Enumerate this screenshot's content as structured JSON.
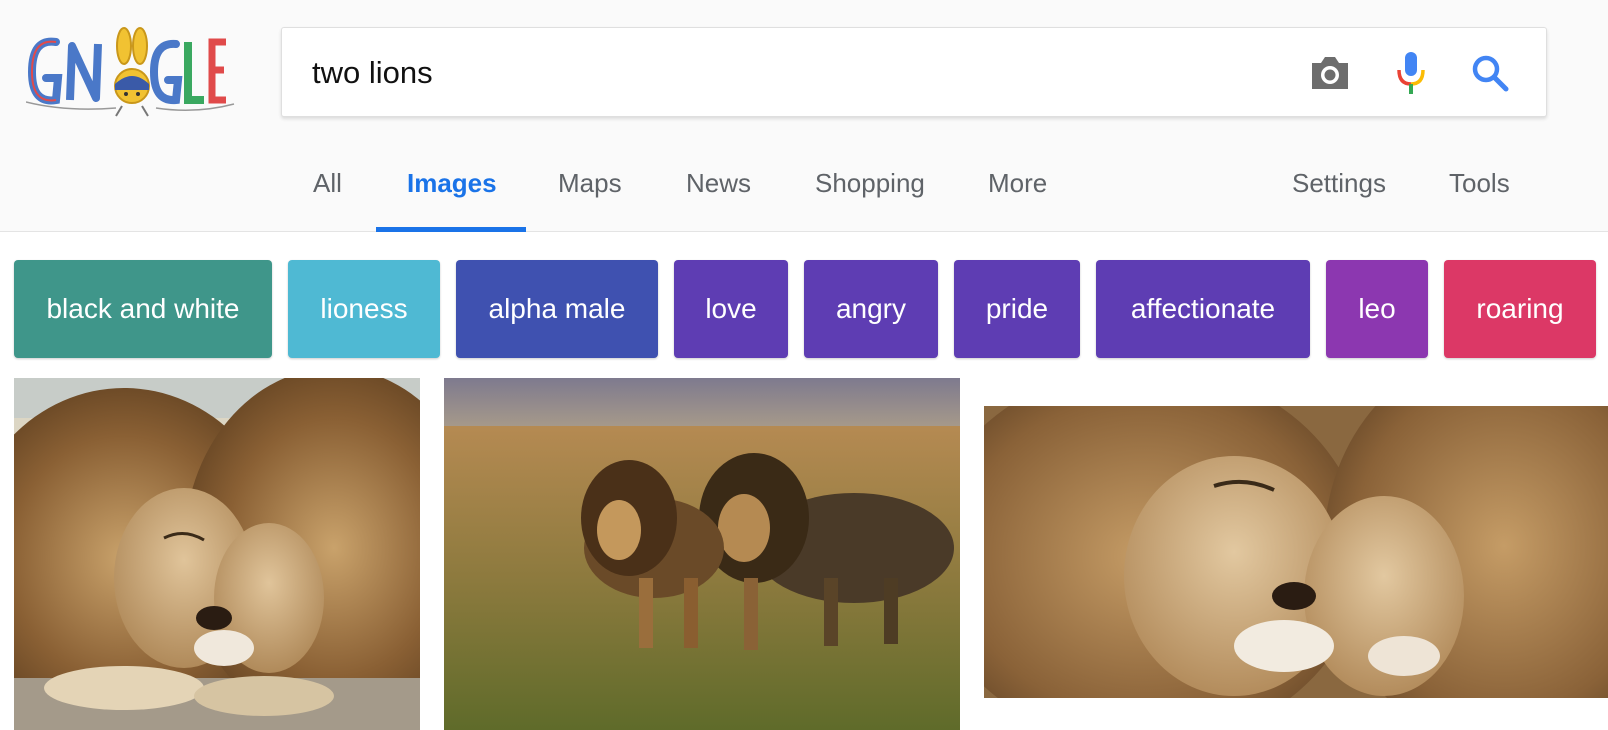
{
  "search": {
    "query": "two lions"
  },
  "icons": {
    "camera": "camera-icon",
    "mic": "microphone-icon",
    "search": "search-icon"
  },
  "tabs": [
    {
      "label": "All"
    },
    {
      "label": "Images"
    },
    {
      "label": "Maps"
    },
    {
      "label": "News"
    },
    {
      "label": "Shopping"
    },
    {
      "label": "More"
    },
    {
      "label": "Settings"
    },
    {
      "label": "Tools"
    }
  ],
  "chips": [
    {
      "label": "black and white",
      "color": "#3f968a"
    },
    {
      "label": "lioness",
      "color": "#4fb9d3"
    },
    {
      "label": "alpha male",
      "color": "#3f51b0"
    },
    {
      "label": "love",
      "color": "#5e3db3"
    },
    {
      "label": "angry",
      "color": "#5e3db3"
    },
    {
      "label": "pride",
      "color": "#5e3db3"
    },
    {
      "label": "affectionate",
      "color": "#5e3db3"
    },
    {
      "label": "leo",
      "color": "#8c37b0"
    },
    {
      "label": "roaring",
      "color": "#dc3866"
    }
  ],
  "colors": {
    "accent": "#1a73e8",
    "tab_text": "#5f6368"
  }
}
